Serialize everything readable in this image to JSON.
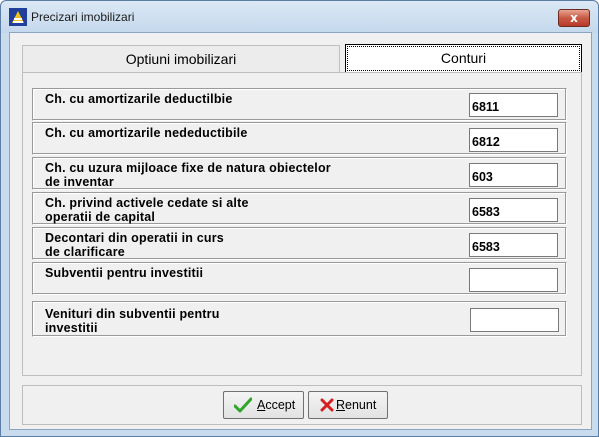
{
  "window": {
    "title": "Precizari imobilizari",
    "close_label": "x"
  },
  "tabs": [
    {
      "label": "Optiuni imobilizari",
      "active": false
    },
    {
      "label": "Conturi",
      "active": true
    }
  ],
  "rows": [
    {
      "label_line1": "Ch. cu amortizarile deductilbie",
      "label_line2": "",
      "value": "6811"
    },
    {
      "label_line1": "Ch. cu amortizarile nedeductibile",
      "label_line2": "",
      "value": "6812"
    },
    {
      "label_line1": "Ch. cu uzura mijloace fixe de natura obiectelor",
      "label_line2": "de inventar",
      "value": "603"
    },
    {
      "label_line1": "Ch. privind activele cedate si alte",
      "label_line2": "operatii de capital",
      "value": "6583"
    },
    {
      "label_line1": "Decontari din operatii in curs",
      "label_line2": "de clarificare",
      "value": "6583"
    },
    {
      "label_line1": "Subventii pentru investitii",
      "label_line2": "",
      "value": ""
    },
    {
      "label_line1": "Venituri din subventii pentru",
      "label_line2": "investitii",
      "value": ""
    }
  ],
  "buttons": {
    "accept_first": "A",
    "accept_rest": "ccept",
    "renunt_first": "R",
    "renunt_rest": "enunt"
  },
  "colors": {
    "accept_icon": "#2fa52a",
    "renunt_icon": "#d42020"
  }
}
